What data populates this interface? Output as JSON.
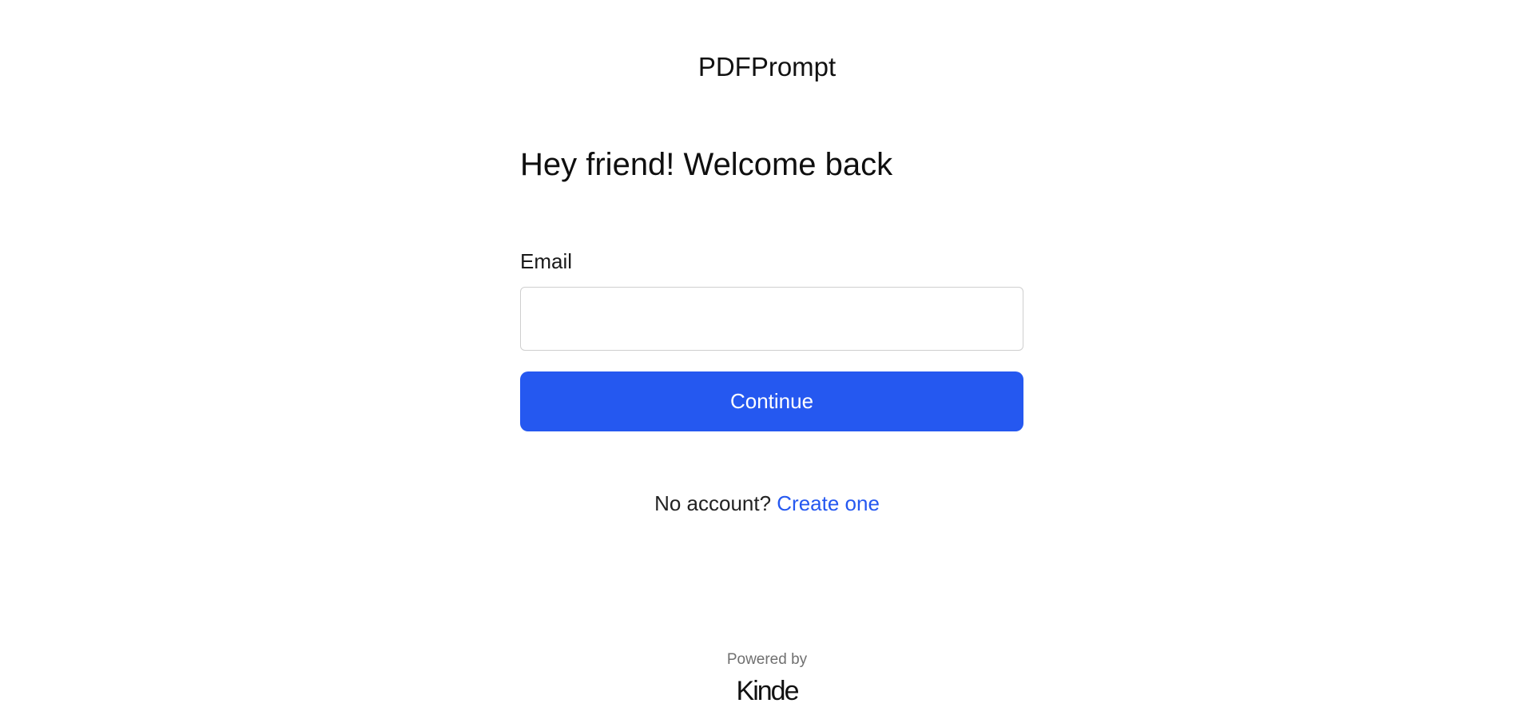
{
  "app": {
    "brand_name": "PDFPrompt"
  },
  "login": {
    "heading": "Hey friend! Welcome back",
    "email_label": "Email",
    "email_value": "",
    "email_placeholder": "",
    "continue_label": "Continue"
  },
  "signup": {
    "prompt": "No account?",
    "link_label": "Create one"
  },
  "footer": {
    "powered_by": "Powered by",
    "provider_logo_text": "Kinde"
  },
  "colors": {
    "accent": "#2558f0",
    "background": "#ffffff",
    "text": "#111111",
    "muted_text": "#707070",
    "input_border": "#cfcfcf"
  }
}
